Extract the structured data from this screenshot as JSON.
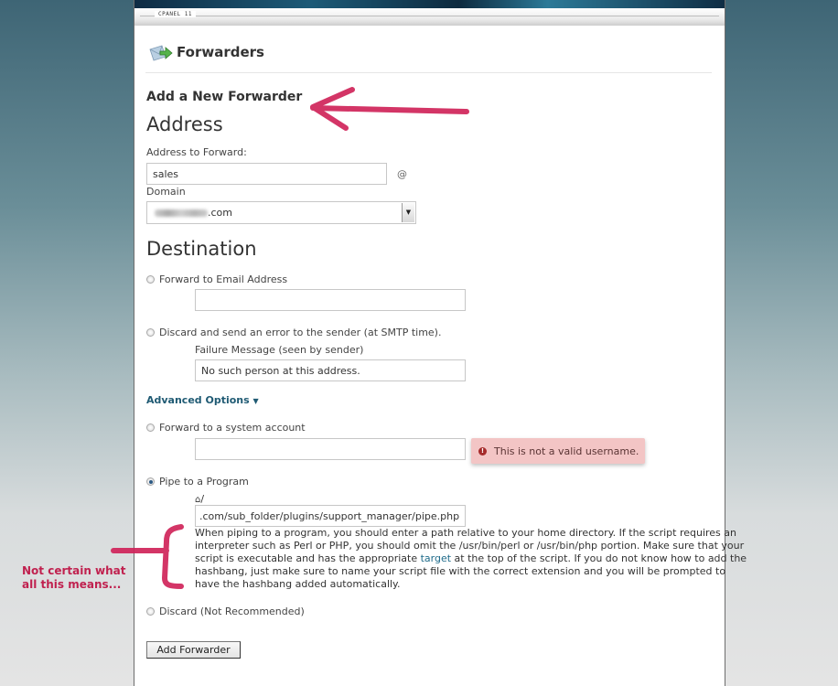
{
  "header": {
    "brand": "CPANEL 11",
    "page_title": "Forwarders",
    "page_icon": "email-forward-icon"
  },
  "form": {
    "section_title": "Add a New Forwarder",
    "address": {
      "heading": "Address",
      "address_label": "Address to Forward:",
      "address_value": "sales",
      "at_symbol": "@",
      "domain_label": "Domain",
      "domain_value_suffix": ".com",
      "domain_value_note": "domain name blurred"
    },
    "destination": {
      "heading": "Destination",
      "options": [
        {
          "label": "Forward to Email Address",
          "checked": false
        },
        {
          "label": "Discard and send an error to the sender (at SMTP time).",
          "checked": false
        },
        {
          "label": "Forward to a system account",
          "checked": false
        },
        {
          "label": "Pipe to a Program",
          "checked": true
        },
        {
          "label": "Discard (Not Recommended)",
          "checked": false
        }
      ],
      "email_value": "",
      "failure_label": "Failure Message (seen by sender)",
      "failure_value": "No such person at this address.",
      "advanced_label": "Advanced Options",
      "advanced_icon": "caret-down-icon",
      "system_account_value": "",
      "system_account_error": "This is not a valid username.",
      "pipe_prefix": "/",
      "pipe_value": ".com/sub_folder/plugins/support_manager/pipe.php",
      "pipe_help_before": "When piping to a program, you should enter a path relative to your home directory. If the script requires an interpreter such as Perl or PHP, you should omit the /usr/bin/perl or /usr/bin/php portion. Make sure that your script is executable and has the appropriate ",
      "pipe_help_link": "target",
      "pipe_help_after": " at the top of the script. If you do not know how to add the hashbang, just make sure to name your script file with the correct extension and you will be prompted to have the hashbang added automatically."
    },
    "submit_label": "Add Forwarder"
  },
  "annotations": {
    "note": "Not certain what all this means...",
    "color": "#c0214f"
  }
}
